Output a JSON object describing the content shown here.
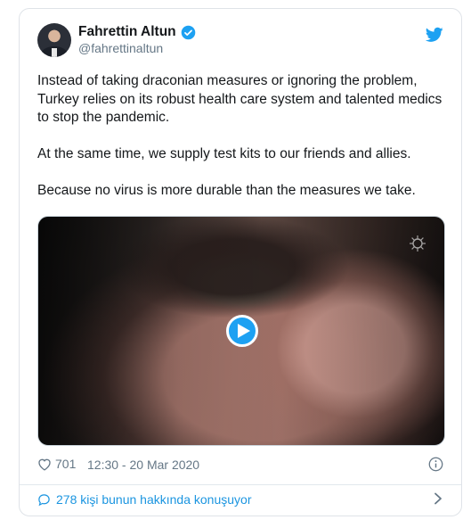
{
  "tweet": {
    "author_name": "Fahrettin Altun",
    "handle": "@fahrettinaltun",
    "paragraphs": [
      "Instead of taking draconian measures or ignoring the problem, Turkey relies on its robust health care system and talented medics to stop the pandemic.",
      "At the same time, we supply test kits to our friends and allies.",
      "Because no virus is more durable than the measures we take."
    ],
    "likes": "701",
    "timestamp": "12:30 - 20 Mar 2020",
    "conversation": "278 kişi bunun hakkında konuşuyor"
  },
  "icons": {
    "verified": "verified-badge-icon",
    "brand": "twitter-bird-icon",
    "play": "play-icon",
    "like": "heart-icon",
    "info": "info-icon",
    "conversation": "speech-bubble-icon",
    "chevron": "chevron-right-icon",
    "watermark": "virus-watermark-icon"
  },
  "colors": {
    "accent": "#1da1f2",
    "link": "#1b95e0",
    "muted": "#657786"
  }
}
